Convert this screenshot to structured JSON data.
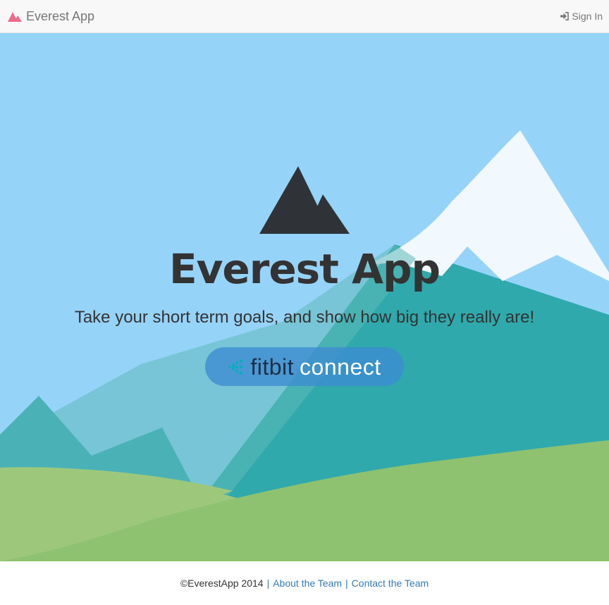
{
  "navbar": {
    "brand": "Everest App",
    "brand_icon": "mountain-icon",
    "signin_label": "Sign In",
    "signin_icon": "sign-in-icon"
  },
  "hero": {
    "title": "Everest App",
    "tagline": "Take your short term goals, and show how big they really are!",
    "connect_button": {
      "brand_part": "fitbit",
      "action_part": "connect",
      "icon": "fitbit-dots-icon"
    }
  },
  "footer": {
    "copyright": "©EverestApp 2014",
    "separator": "|",
    "links": [
      "About the Team",
      "Contact the Team"
    ]
  },
  "colors": {
    "sky": "#96d3f9",
    "mountain_teal": "#2fa9ac",
    "snow": "#f1f8fe",
    "grass": "#8ec270",
    "brand_pink": "#f06b8b",
    "link": "#337ab7"
  }
}
